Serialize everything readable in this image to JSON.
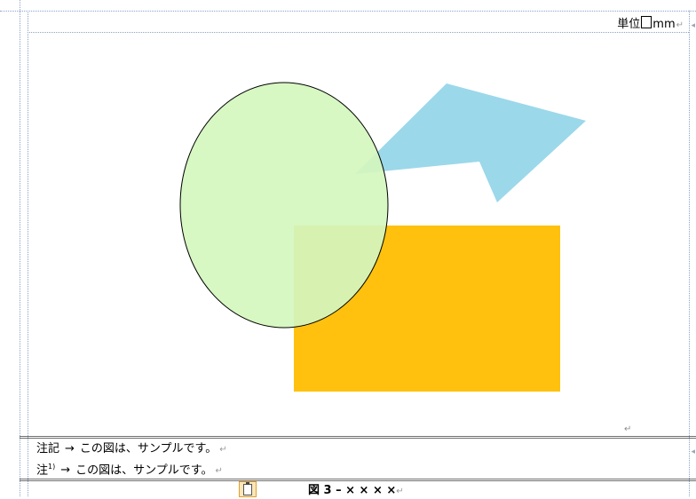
{
  "header": {
    "unit_prefix": "単位",
    "unit_suffix": "mm"
  },
  "figure": {
    "shapes": [
      {
        "kind": "rectangle",
        "color": "#FFC10E"
      },
      {
        "kind": "ellipse",
        "color": "#D4F6BE",
        "stroke": "#000000"
      },
      {
        "kind": "arrow-polygon",
        "color": "#9BD8EA"
      }
    ]
  },
  "notes": [
    {
      "label": "注記",
      "arrow": "→",
      "text": "この図は、サンプルです。"
    },
    {
      "label": "注",
      "sup": "1)",
      "arrow": "→",
      "text": "この図は、サンプルです。"
    }
  ],
  "caption": {
    "text": "図 3 – × × × ×"
  },
  "marks": {
    "return": "↵",
    "side_arrow": "◂"
  },
  "icons": {
    "paste": "paste-options-icon"
  }
}
